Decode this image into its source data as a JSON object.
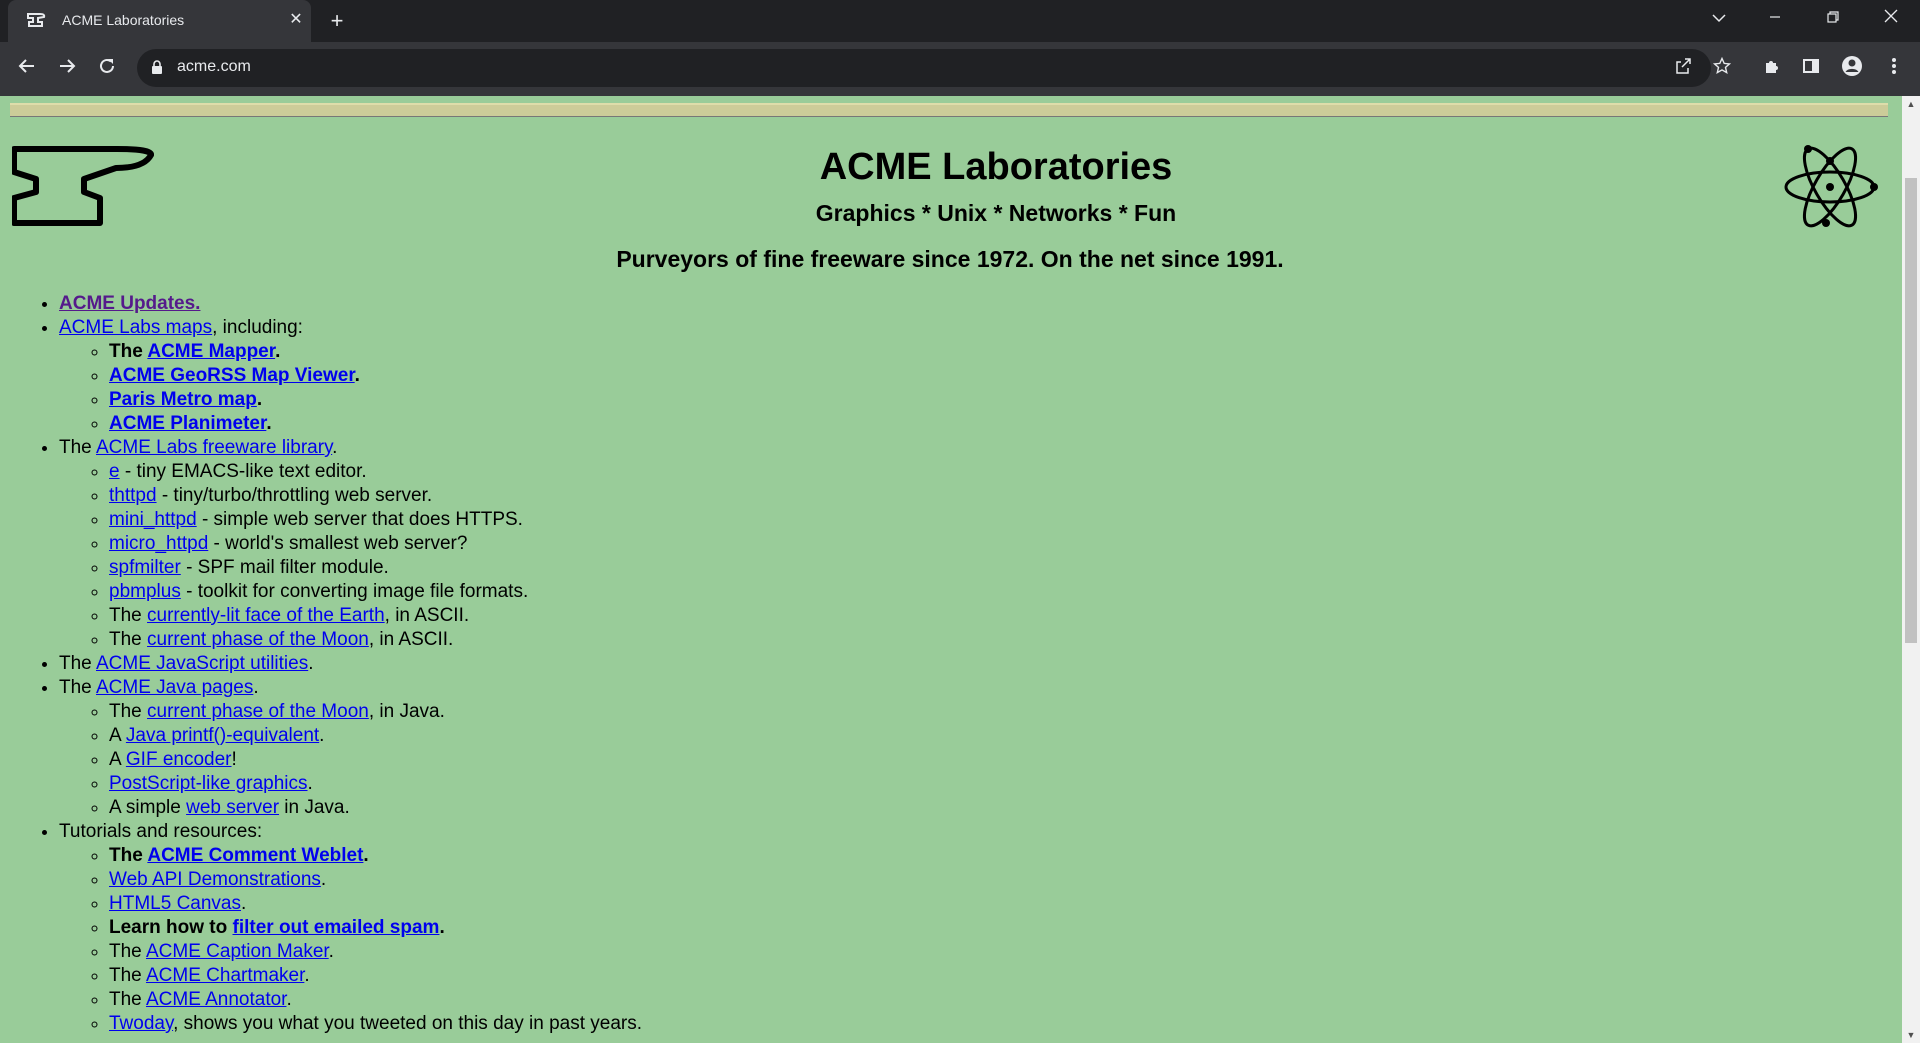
{
  "browser": {
    "tab_title": "ACME Laboratories",
    "tab_close": "✕",
    "new_tab": "+",
    "url": "acme.com",
    "icons": [
      "tab-search-icon",
      "minimize-icon",
      "restore-icon",
      "close-icon",
      "back-icon",
      "forward-icon",
      "reload-icon",
      "lock-icon",
      "share-icon",
      "star-icon",
      "extensions-icon",
      "side-panel-icon",
      "profile-icon",
      "menu-icon"
    ]
  },
  "header": {
    "title": "ACME Laboratories",
    "subtitle": "Graphics * Unix * Networks * Fun",
    "tagline": "Purveyors of fine freeware since 1972. On the net since 1991."
  },
  "list": {
    "updates": "ACME Updates.",
    "maps_link": "ACME Labs maps",
    "maps_suffix": ", including:",
    "maps": {
      "the": "The ",
      "mapper": "ACME Mapper",
      "mapper_end": ".",
      "georss": "ACME GeoRSS Map Viewer",
      "georss_end": ".",
      "paris": "Paris Metro map",
      "paris_end": ".",
      "planimeter": "ACME Planimeter",
      "planimeter_end": "."
    },
    "freeware": {
      "prefix": "The ",
      "link": "ACME Labs freeware library",
      "suffix": ".",
      "items": [
        {
          "pre": "",
          "link": "e",
          "post": " - tiny EMACS-like text editor."
        },
        {
          "pre": "",
          "link": "thttpd",
          "post": " - tiny/turbo/throttling web server."
        },
        {
          "pre": "",
          "link": "mini_httpd",
          "post": " - simple web server that does HTTPS."
        },
        {
          "pre": "",
          "link": "micro_httpd",
          "post": " - world's smallest web server?"
        },
        {
          "pre": "",
          "link": "spfmilter",
          "post": " - SPF mail filter module."
        },
        {
          "pre": "",
          "link": "pbmplus",
          "post": " - toolkit for converting image file formats."
        },
        {
          "pre": "The ",
          "link": "currently-lit face of the Earth",
          "post": ", in ASCII."
        },
        {
          "pre": "The ",
          "link": "current phase of the Moon",
          "post": ", in ASCII."
        }
      ]
    },
    "javascript": {
      "prefix": "The ",
      "link": "ACME JavaScript utilities",
      "suffix": "."
    },
    "java": {
      "prefix": "The ",
      "link": "ACME Java pages",
      "suffix": ".",
      "items": [
        {
          "pre": "The ",
          "link": "current phase of the Moon",
          "post": ", in Java."
        },
        {
          "pre": "A ",
          "link": "Java printf()-equivalent",
          "post": "."
        },
        {
          "pre": "A ",
          "link": "GIF encoder",
          "post": "!"
        },
        {
          "pre": "",
          "link": "PostScript-like graphics",
          "post": "."
        },
        {
          "pre": "A simple ",
          "link": "web server",
          "post": " in Java."
        }
      ]
    },
    "tutorials": {
      "label": "Tutorials and resources:",
      "weblet": {
        "pre": "The ",
        "link": "ACME Comment Weblet",
        "post": "."
      },
      "webapi": {
        "link": "Web API Demonstrations",
        "post": "."
      },
      "canvas": {
        "link": "HTML5 Canvas",
        "post": "."
      },
      "spam": {
        "pre": "Learn how to ",
        "link": "filter out emailed spam",
        "post": "."
      },
      "caption": {
        "pre": "The ",
        "link": "ACME Caption Maker",
        "post": "."
      },
      "chartmaker": {
        "pre": "The ",
        "link": "ACME Chartmaker",
        "post": "."
      },
      "annotator": {
        "pre": "The ",
        "link": "ACME Annotator",
        "post": "."
      },
      "twoday": {
        "link": "Twoday",
        "post": ", shows you what you tweeted on this day in past years."
      }
    }
  },
  "colors": {
    "page_bg": "#99cc99",
    "link": "#0000ee",
    "visited": "#551a8b",
    "chrome_dark": "#202124",
    "chrome_mid": "#35363a"
  }
}
